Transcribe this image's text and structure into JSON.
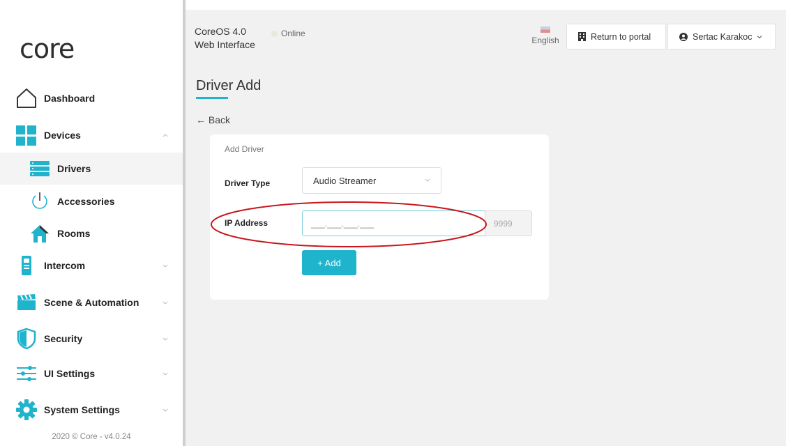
{
  "sidebar": {
    "logo": "core",
    "items": [
      {
        "label": "Dashboard",
        "icon": "home-icon"
      },
      {
        "label": "Devices",
        "icon": "grid-icon"
      },
      {
        "label": "Drivers",
        "icon": "server-icon"
      },
      {
        "label": "Accessories",
        "icon": "power-icon"
      },
      {
        "label": "Rooms",
        "icon": "house-icon"
      },
      {
        "label": "Intercom",
        "icon": "intercom-icon"
      },
      {
        "label": "Scene & Automation",
        "icon": "clapperboard-icon"
      },
      {
        "label": "Security",
        "icon": "shield-icon"
      },
      {
        "label": "UI Settings",
        "icon": "sliders-icon"
      },
      {
        "label": "System Settings",
        "icon": "gear-icon"
      }
    ],
    "footer": "2020 © Core - v4.0.24"
  },
  "header": {
    "title_line1": "CoreOS 4.0",
    "title_line2": "Web Interface",
    "status": "Online",
    "language": "English",
    "return_label": "Return to portal",
    "user_label": "Sertac Karakoc"
  },
  "page": {
    "title": "Driver Add",
    "back_label": "Back"
  },
  "form": {
    "card_title": "Add Driver",
    "driver_type_label": "Driver Type",
    "driver_type_value": "Audio Streamer",
    "ip_label": "IP Address",
    "ip_placeholder": "___.___.___.___",
    "port_placeholder": "9999",
    "add_label": "+ Add"
  },
  "colors": {
    "accent": "#1fb3cc",
    "annotation": "#c9151b"
  }
}
